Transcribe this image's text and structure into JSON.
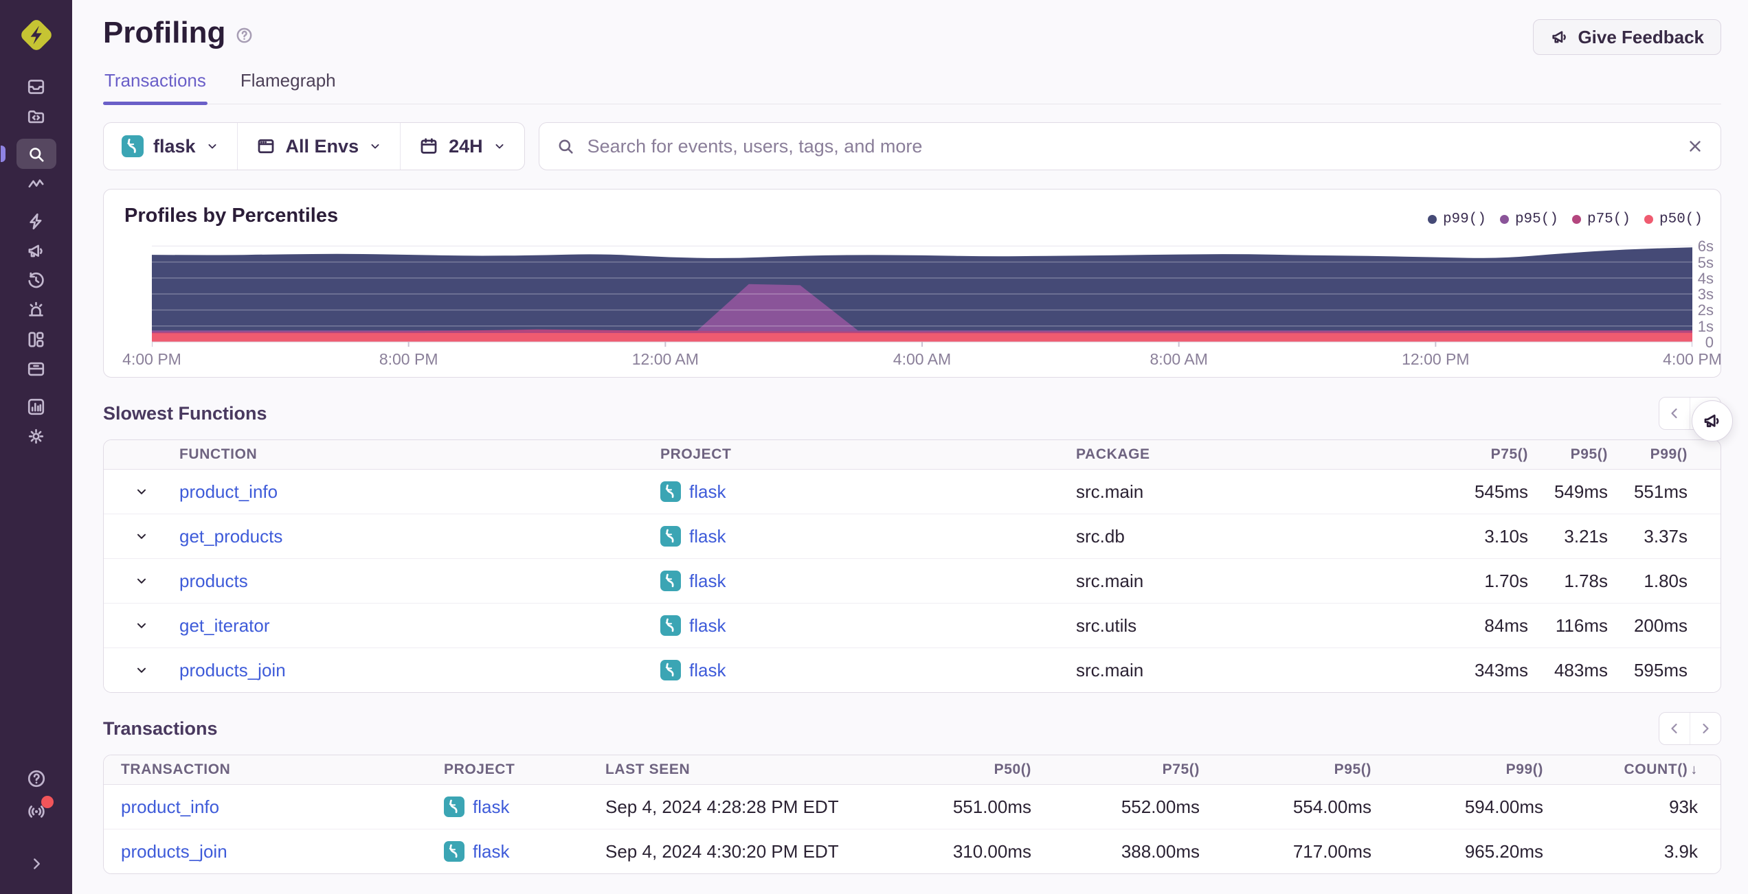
{
  "app": {
    "name": "Sentry"
  },
  "colors": {
    "accent": "#6A5FC8",
    "link": "#3E5BD9",
    "sidebar_bg": "#362442",
    "flask_badge": "#3BA5B4",
    "p99": "#454A76",
    "p95": "#8A5499",
    "p75": "#B4467E",
    "p50": "#EF5B70",
    "notification": "#F2555A"
  },
  "sidebar": {
    "logo_icon": "sentry-logo",
    "groups": [
      {
        "items": [
          {
            "icon": "issues"
          },
          {
            "icon": "projects"
          }
        ]
      },
      {
        "items": [
          {
            "icon": "explore",
            "active": true
          },
          {
            "icon": "traces"
          }
        ]
      },
      {
        "items": [
          {
            "icon": "boost"
          },
          {
            "icon": "feedback"
          },
          {
            "icon": "replays"
          },
          {
            "icon": "alerts"
          },
          {
            "icon": "dashboards"
          },
          {
            "icon": "releases"
          }
        ]
      },
      {
        "items": [
          {
            "icon": "stats"
          },
          {
            "icon": "settings"
          }
        ]
      }
    ],
    "bottom": [
      {
        "icon": "help"
      },
      {
        "icon": "whats-new",
        "badge": true
      },
      {
        "icon": "expand"
      }
    ]
  },
  "header": {
    "title": "Profiling",
    "feedback_label": "Give Feedback"
  },
  "tabs": [
    {
      "label": "Transactions",
      "active": true
    },
    {
      "label": "Flamegraph",
      "active": false
    }
  ],
  "filters": {
    "project_label": "flask",
    "env_label": "All Envs",
    "range_label": "24H",
    "search_placeholder": "Search for events, users, tags, and more"
  },
  "chart_panel": {
    "title": "Profiles by Percentiles"
  },
  "chart_data": {
    "type": "area",
    "title": "Profiles by Percentiles",
    "x_axis": "time (last 24H, 4:00 PM to 4:00 PM)",
    "x_tick_labels": [
      "4:00 PM",
      "8:00 PM",
      "12:00 AM",
      "4:00 AM",
      "8:00 AM",
      "12:00 PM",
      "4:00 PM"
    ],
    "x_tick_hours": [
      0,
      4,
      8,
      12,
      16,
      20,
      24
    ],
    "y_tick_labels": [
      "6s",
      "5s",
      "4s",
      "3s",
      "2s",
      "1s",
      "0"
    ],
    "y_tick_values": [
      6,
      5,
      4,
      3,
      2,
      1,
      0
    ],
    "ylim": [
      0,
      6.1
    ],
    "grid": true,
    "legend_position": "top-right",
    "series": [
      {
        "name": "p99()",
        "color": "#454A76",
        "smooth": true,
        "points": [
          [
            0,
            5.45
          ],
          [
            1,
            5.42
          ],
          [
            2,
            5.48
          ],
          [
            3,
            5.52
          ],
          [
            4,
            5.45
          ],
          [
            5,
            5.38
          ],
          [
            6,
            5.42
          ],
          [
            7,
            5.52
          ],
          [
            8,
            5.3
          ],
          [
            9,
            5.22
          ],
          [
            10,
            5.38
          ],
          [
            11,
            5.45
          ],
          [
            12,
            5.42
          ],
          [
            13,
            5.35
          ],
          [
            14,
            5.38
          ],
          [
            15,
            5.42
          ],
          [
            16,
            5.48
          ],
          [
            17,
            5.5
          ],
          [
            18,
            5.42
          ],
          [
            19,
            5.38
          ],
          [
            20,
            5.3
          ],
          [
            21,
            5.22
          ],
          [
            22,
            5.55
          ],
          [
            23,
            5.8
          ],
          [
            24,
            5.92
          ]
        ]
      },
      {
        "name": "p95()",
        "color": "#8A5499",
        "smooth": false,
        "points": [
          [
            0,
            0.72
          ],
          [
            8.5,
            0.72
          ],
          [
            9.3,
            3.62
          ],
          [
            10.1,
            3.55
          ],
          [
            11.0,
            0.72
          ],
          [
            24,
            0.72
          ]
        ]
      },
      {
        "name": "p75()",
        "color": "#B4467E",
        "smooth": false,
        "points": [
          [
            0,
            0.62
          ],
          [
            4,
            0.66
          ],
          [
            6,
            0.78
          ],
          [
            8,
            0.7
          ],
          [
            12,
            0.64
          ],
          [
            18,
            0.66
          ],
          [
            22,
            0.7
          ],
          [
            24,
            0.72
          ]
        ]
      },
      {
        "name": "p50()",
        "color": "#EF5B70",
        "smooth": false,
        "points": [
          [
            0,
            0.55
          ],
          [
            6,
            0.56
          ],
          [
            12,
            0.55
          ],
          [
            18,
            0.55
          ],
          [
            24,
            0.57
          ]
        ]
      }
    ]
  },
  "slowest_functions": {
    "heading": "Slowest Functions",
    "columns": [
      "FUNCTION",
      "PROJECT",
      "PACKAGE",
      "P75()",
      "P95()",
      "P99()"
    ],
    "rows": [
      {
        "function": "product_info",
        "project": "flask",
        "package": "src.main",
        "p75": "545ms",
        "p95": "549ms",
        "p99": "551ms"
      },
      {
        "function": "get_products",
        "project": "flask",
        "package": "src.db",
        "p75": "3.10s",
        "p95": "3.21s",
        "p99": "3.37s"
      },
      {
        "function": "products",
        "project": "flask",
        "package": "src.main",
        "p75": "1.70s",
        "p95": "1.78s",
        "p99": "1.80s"
      },
      {
        "function": "get_iterator",
        "project": "flask",
        "package": "src.utils",
        "p75": "84ms",
        "p95": "116ms",
        "p99": "200ms"
      },
      {
        "function": "products_join",
        "project": "flask",
        "package": "src.main",
        "p75": "343ms",
        "p95": "483ms",
        "p99": "595ms"
      }
    ]
  },
  "transactions": {
    "heading": "Transactions",
    "columns": [
      "TRANSACTION",
      "PROJECT",
      "LAST SEEN",
      "P50()",
      "P75()",
      "P95()",
      "P99()",
      "COUNT()"
    ],
    "sort_column": "COUNT()",
    "sort_arrow": "↓",
    "rows": [
      {
        "transaction": "product_info",
        "project": "flask",
        "last_seen": "Sep 4, 2024 4:28:28 PM EDT",
        "p50": "551.00ms",
        "p75": "552.00ms",
        "p95": "554.00ms",
        "p99": "594.00ms",
        "count": "93k"
      },
      {
        "transaction": "products_join",
        "project": "flask",
        "last_seen": "Sep 4, 2024 4:30:20 PM EDT",
        "p50": "310.00ms",
        "p75": "388.00ms",
        "p95": "717.00ms",
        "p99": "965.20ms",
        "count": "3.9k"
      }
    ]
  }
}
